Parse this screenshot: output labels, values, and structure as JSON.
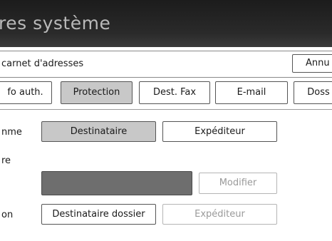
{
  "header": {
    "title": "res système"
  },
  "breadcrumb": {
    "text": "carnet d'adresses"
  },
  "toolbar": {
    "cancel_label": "Annu"
  },
  "tabs": [
    {
      "label": "fo auth.",
      "active": false
    },
    {
      "label": "Protection",
      "active": true
    },
    {
      "label": "Dest. Fax",
      "active": false
    },
    {
      "label": "E-mail",
      "active": false
    },
    {
      "label": "Doss",
      "active": false
    }
  ],
  "rows": {
    "row1_label": "nme",
    "row1_options": [
      "Destinataire",
      "Expéditeur"
    ],
    "row2_label": "re",
    "modify_label": "Modifier",
    "row3_label": "on",
    "row3_options": [
      "Destinataire dossier",
      "Expéditeur"
    ]
  },
  "colors": {
    "titlebar": "#1c1c1c",
    "selected": "#c8c8c8",
    "field": "#6e6e6e"
  }
}
